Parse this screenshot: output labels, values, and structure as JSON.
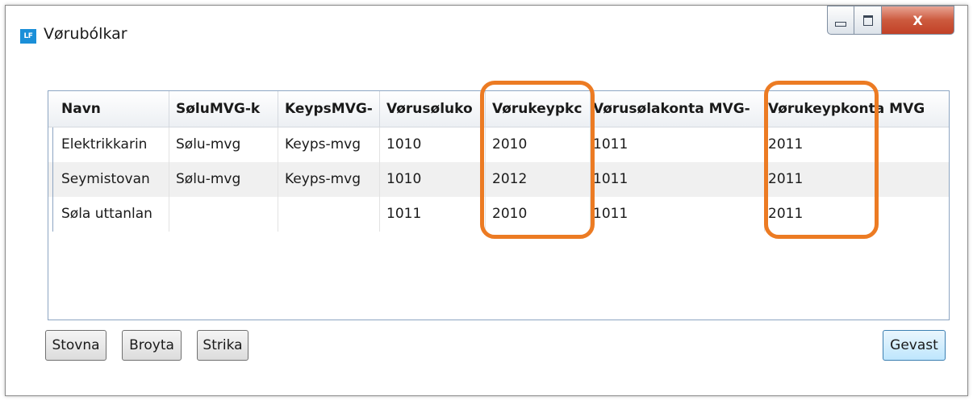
{
  "window": {
    "icon_text": "LF",
    "title": "Vørubólkar",
    "close_glyph": "X"
  },
  "grid": {
    "columns": [
      "Navn",
      "SøluMVG-k",
      "KeypsMVG-",
      "Vørusøluko",
      "Vørukeypkc",
      "Vørusølakonta MVG-",
      "Vørukeypkonta MVG"
    ],
    "rows": [
      [
        "Elektrikkarin",
        "Sølu-mvg",
        "Keyps-mvg",
        "1010",
        "2010",
        "1011",
        "2011"
      ],
      [
        "Seymistovan",
        "Sølu-mvg",
        "Keyps-mvg",
        "1010",
        "2012",
        "1011",
        "2011"
      ],
      [
        "Søla uttanlan",
        "",
        "",
        "1011",
        "2010",
        "1011",
        "2011"
      ]
    ]
  },
  "buttons": {
    "new": "Stovna",
    "edit": "Broyta",
    "delete": "Strika",
    "save": "Gevast"
  },
  "colors": {
    "highlight": "#ec7b23",
    "accent": "#1a8fd8"
  }
}
